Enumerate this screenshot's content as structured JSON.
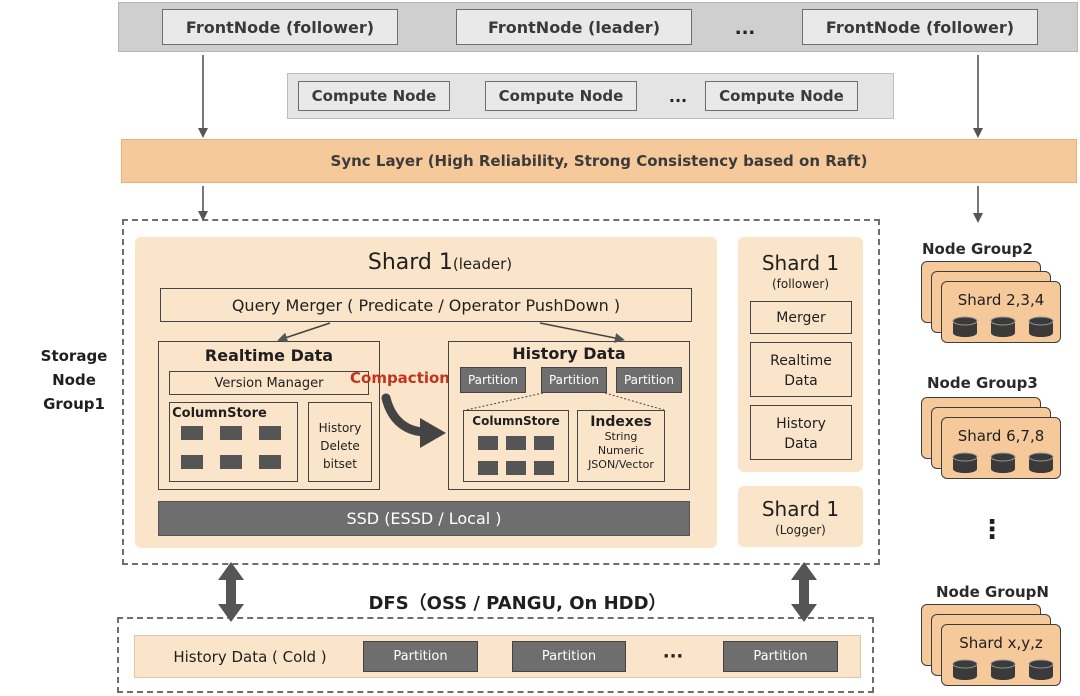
{
  "front": {
    "follower_left": "FrontNode (follower)",
    "leader": "FrontNode (leader)",
    "ellipsis": "...",
    "follower_right": "FrontNode (follower)"
  },
  "compute": {
    "node_1": "Compute Node",
    "node_2": "Compute Node",
    "ellipsis": "...",
    "node_3": "Compute Node"
  },
  "sync_layer": "Sync Layer (High Reliability, Strong Consistency based on Raft)",
  "storage_group": {
    "line1": "Storage",
    "line2": "Node",
    "line3": "Group1"
  },
  "shard_leader": {
    "title": "Shard 1",
    "role": "(leader)",
    "query_merger": "Query Merger  ( Predicate / Operator PushDown )",
    "realtime": {
      "title": "Realtime Data",
      "version_manager": "Version Manager",
      "columnstore": "ColumnStore",
      "history_delete": [
        "History",
        "Delete",
        "bitset"
      ]
    },
    "compaction": "Compaction",
    "history": {
      "title": "History Data",
      "partitions": [
        "Partition",
        "Partition",
        "Partition"
      ],
      "columnstore": "ColumnStore",
      "indexes_title": "Indexes",
      "indexes": [
        "String",
        "Numeric",
        "JSON/Vector"
      ]
    },
    "ssd": "SSD (ESSD / Local )"
  },
  "shard_follower": {
    "title": "Shard 1",
    "role": "(follower)",
    "merger": "Merger",
    "realtime": [
      "Realtime",
      "Data"
    ],
    "history": [
      "History",
      "Data"
    ]
  },
  "shard_logger": {
    "title": "Shard 1",
    "role": "(Logger)"
  },
  "dfs": {
    "title": "DFS（OSS / PANGU,   On HDD）",
    "history_cold": "History Data ( Cold )",
    "partitions": [
      "Partition",
      "Partition",
      "Partition"
    ],
    "ellipsis": "···"
  },
  "node_groups": [
    {
      "title": "Node Group2",
      "shards": "Shard 2,3,4"
    },
    {
      "title": "Node Group3",
      "shards": "Shard 6,7,8"
    },
    {
      "title": "Node GroupN",
      "shards": "Shard x,y,z"
    }
  ],
  "node_group_ellipsis": "⋮",
  "colors": {
    "sync_layer": "#f6c99a",
    "shard_background": "#fbe5ca",
    "dark_block": "#6e6e6e",
    "compaction": "#c4321c"
  }
}
